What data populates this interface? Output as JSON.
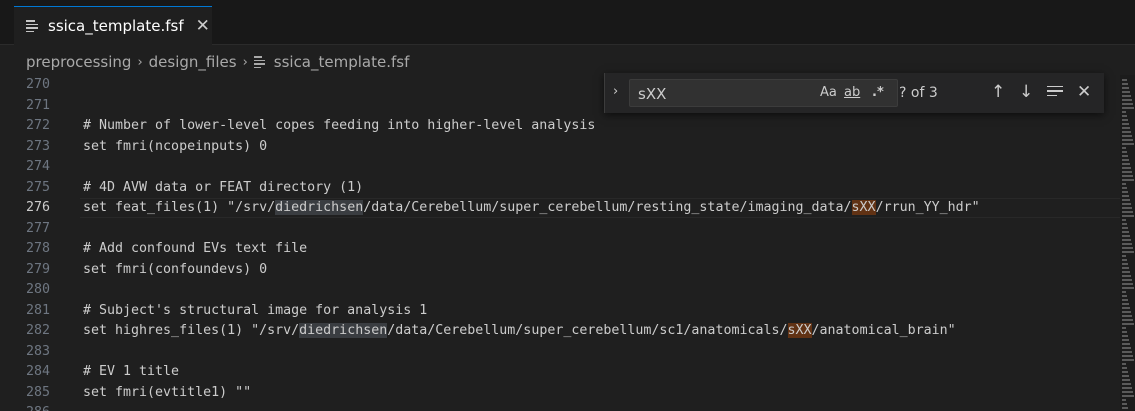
{
  "tab": {
    "title": "ssica_template.fsf",
    "close_glyph": "✕",
    "icon": "file-text-icon"
  },
  "breadcrumb": {
    "items": [
      "preprocessing",
      "design_files",
      "ssica_template.fsf"
    ],
    "separator": "›"
  },
  "find": {
    "query": "sXX",
    "count_label": "? of 3",
    "toggle_glyph": "›",
    "match_case": "Aa",
    "whole_word": "ab",
    "regex": ".*",
    "up_glyph": "↑",
    "down_glyph": "↓",
    "close_glyph": "✕"
  },
  "editor": {
    "current_line": "276",
    "lines": [
      {
        "num": "270",
        "code": ""
      },
      {
        "num": "271",
        "code": ""
      },
      {
        "num": "272",
        "code": "# Number of lower-level copes feeding into higher-level analysis"
      },
      {
        "num": "273",
        "code": "set fmri(ncopeinputs) 0"
      },
      {
        "num": "274",
        "code": ""
      },
      {
        "num": "275",
        "code": "# 4D AVW data or FEAT directory (1)"
      },
      {
        "num": "276",
        "pre": "set feat_files(1) \"/srv/",
        "word": "diedrichsen",
        "mid": "/data/Cerebellum/super_cerebellum/resting_state/imaging_data/",
        "match": "sXX",
        "post": "/rrun_YY_hdr\""
      },
      {
        "num": "277",
        "code": ""
      },
      {
        "num": "278",
        "code": "# Add confound EVs text file"
      },
      {
        "num": "279",
        "code": "set fmri(confoundevs) 0"
      },
      {
        "num": "280",
        "code": ""
      },
      {
        "num": "281",
        "code": "# Subject's structural image for analysis 1"
      },
      {
        "num": "282",
        "pre": "set highres_files(1) \"/srv/",
        "word": "diedrichsen",
        "mid": "/data/Cerebellum/super_cerebellum/sc1/anatomicals/",
        "match": "sXX",
        "post": "/anatomical_brain\""
      },
      {
        "num": "283",
        "code": ""
      },
      {
        "num": "284",
        "code": "# EV 1 title"
      },
      {
        "num": "285",
        "code": "set fmri(evtitle1) \"\""
      },
      {
        "num": "286",
        "code": ""
      }
    ]
  },
  "colors": {
    "match_highlight": "#613214",
    "word_highlight": "#3a3d41",
    "active_tab_border": "#0078d4"
  }
}
